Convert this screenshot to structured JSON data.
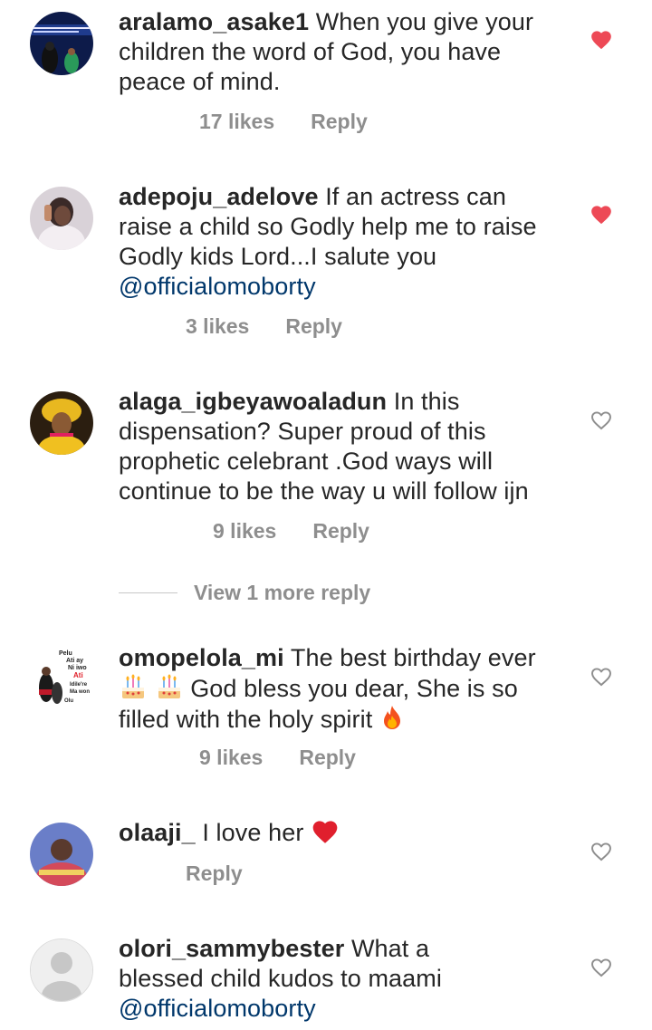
{
  "comments": [
    {
      "username": "aralamo_asake1",
      "text": "When you give your children the word of God, you have peace of mind.",
      "likes": "17 likes",
      "reply": "Reply",
      "liked": true
    },
    {
      "username": "adepoju_adelove",
      "text": "If an actress can raise a child so Godly help me to raise Godly kids Lord...I salute you ",
      "mention": "@officialomoborty",
      "likes": "3 likes",
      "reply": "Reply",
      "liked": true
    },
    {
      "username": "alaga_igbeyawoaladun",
      "text": "In this dispensation? Super proud of this prophetic celebrant .God ways will continue to be the way u will follow ijn",
      "likes": "9 likes",
      "reply": "Reply",
      "liked": false
    },
    {
      "username": "omopelola_mi",
      "text_a": "The best birthday ever ",
      "text_b": " God bless you dear, She is so filled with the holy spirit ",
      "likes": "9 likes",
      "reply": "Reply",
      "liked": false
    },
    {
      "username": "olaaji_",
      "text": "I love her ",
      "reply": "Reply",
      "liked": false
    },
    {
      "username": "olori_sammybester",
      "text": "What a blessed child kudos to maami ",
      "mention": "@officialomoborty",
      "liked": false
    }
  ],
  "view_more": "View 1 more reply",
  "avatar_sign_text": [
    "Pelu",
    "Ati ay",
    "Ni iwo",
    "Ati",
    "Idile're",
    "Ma won",
    "Olu"
  ],
  "colors": {
    "text": "#262626",
    "meta": "#8e8e8e",
    "mention": "#00376b",
    "heart_liked": "#ed4956",
    "heart_outline": "#8e8e8e"
  },
  "icons": {
    "liked": "heart-filled-icon",
    "unliked": "heart-outline-icon",
    "cake": "birthday-cake-emoji",
    "fire": "fire-emoji",
    "red_heart": "red-heart-emoji"
  }
}
